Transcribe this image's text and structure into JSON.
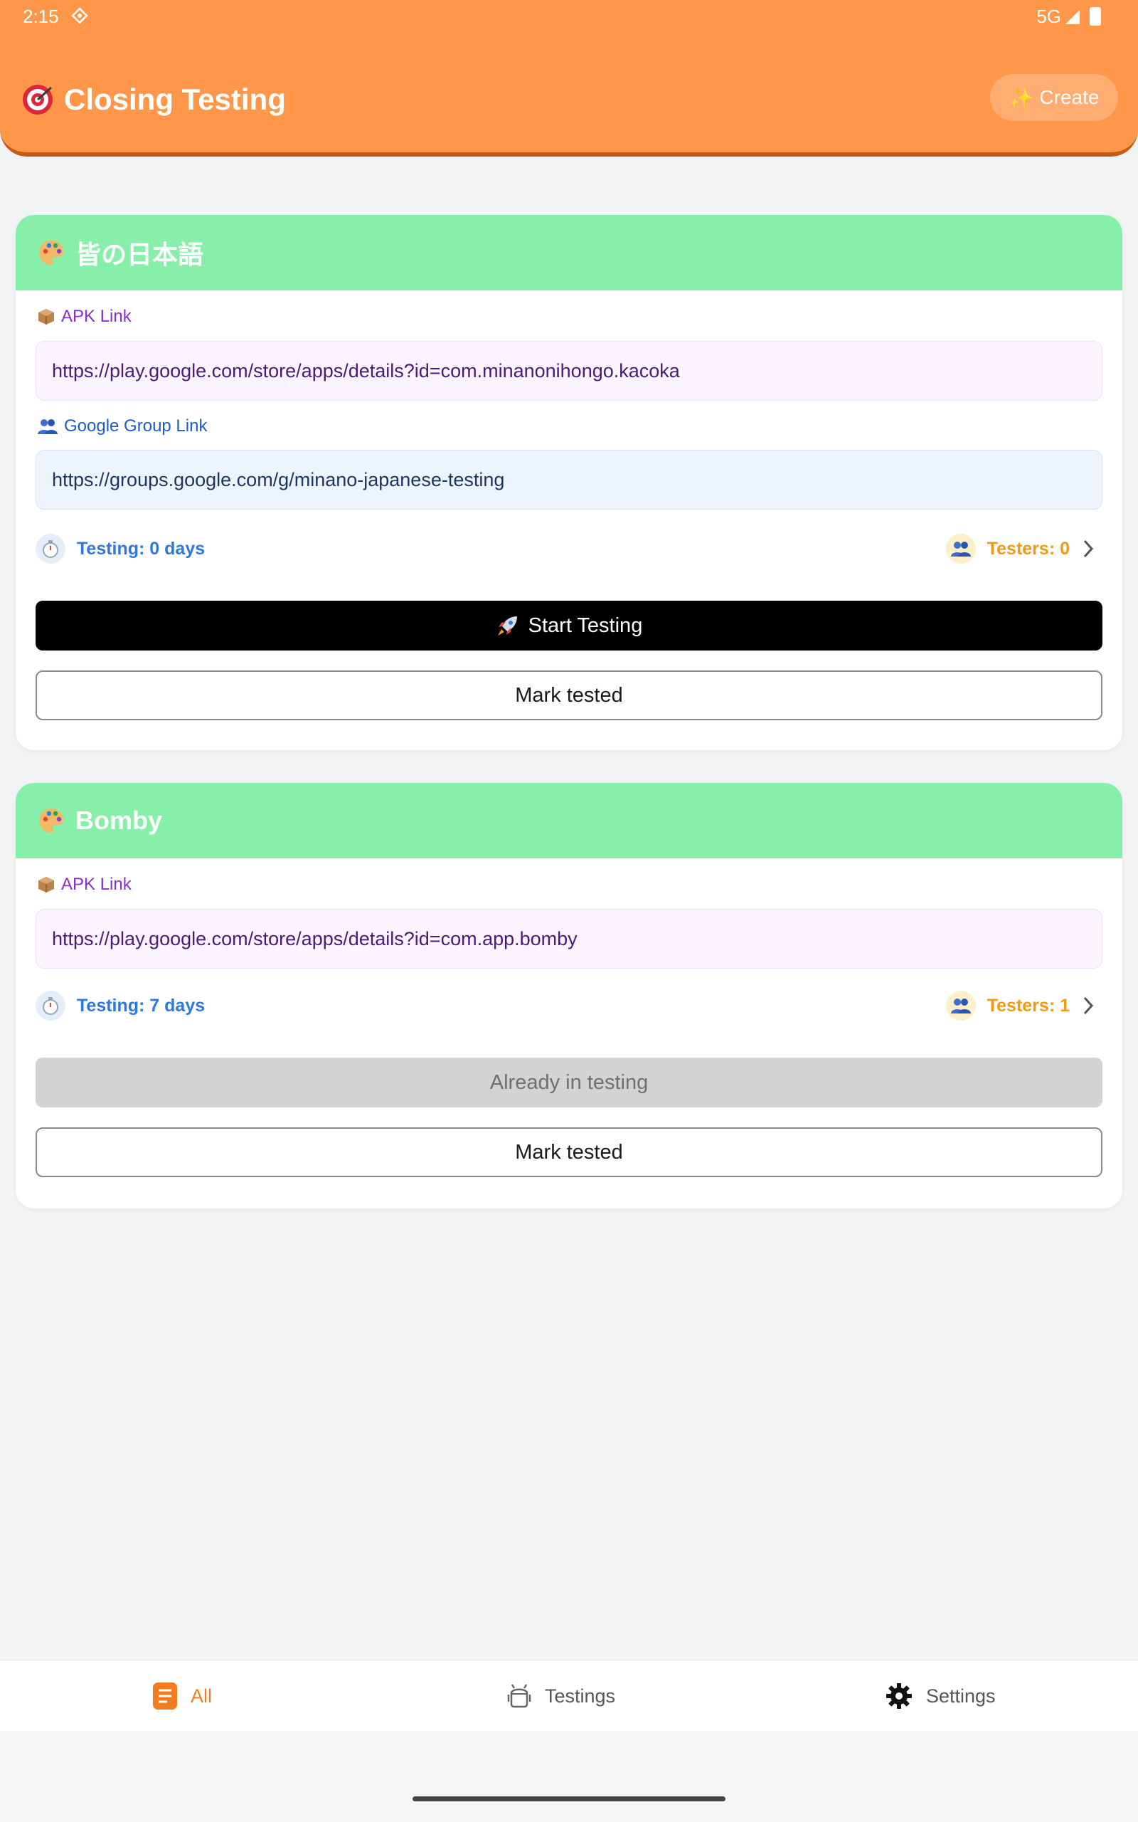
{
  "status_bar": {
    "time": "2:15",
    "network": "5G"
  },
  "header": {
    "title": "Closing Testing",
    "create_label": "Create"
  },
  "apps": [
    {
      "name": "皆の日本語",
      "apk_label": "APK Link",
      "apk_url": "https://play.google.com/store/apps/details?id=com.minanonihongo.kacoka",
      "group_label": "Google Group Link",
      "group_url": "https://groups.google.com/g/minano-japanese-testing",
      "testing_text": "Testing: 0 days",
      "testers_text": "Testers: 0",
      "primary_button": "Start Testing",
      "mark_button": "Mark tested"
    },
    {
      "name": "Bomby",
      "apk_label": "APK Link",
      "apk_url": "https://play.google.com/store/apps/details?id=com.app.bomby",
      "testing_text": "Testing: 7 days",
      "testers_text": "Testers: 1",
      "primary_button": "Already in testing",
      "mark_button": "Mark tested"
    }
  ],
  "bottom_nav": {
    "items": [
      {
        "label": "All",
        "icon": "list-icon",
        "active": true
      },
      {
        "label": "Testings",
        "icon": "android-icon",
        "active": false
      },
      {
        "label": "Settings",
        "icon": "gear-icon",
        "active": false
      }
    ]
  },
  "colors": {
    "header": "#ff974a",
    "card_header": "#88efaa",
    "accent": "#f47c20",
    "testing": "#2f78e0",
    "testers": "#f29a14"
  }
}
